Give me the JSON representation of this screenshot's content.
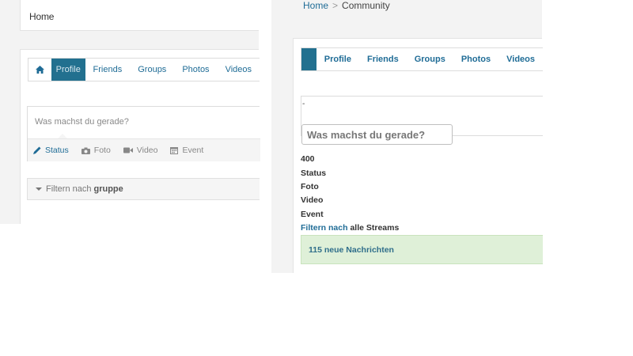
{
  "left": {
    "header": {
      "home_label": "Home"
    },
    "nav": {
      "items": [
        {
          "label": "Profile",
          "active": true
        },
        {
          "label": "Friends"
        },
        {
          "label": "Groups"
        },
        {
          "label": "Photos"
        },
        {
          "label": "Videos"
        }
      ]
    },
    "status": {
      "placeholder": "Was machst du gerade?",
      "options": [
        {
          "label": "Status",
          "icon": "pencil-icon"
        },
        {
          "label": "Foto",
          "icon": "camera-icon"
        },
        {
          "label": "Video",
          "icon": "video-camera-icon"
        },
        {
          "label": "Event",
          "icon": "calendar-icon"
        }
      ]
    },
    "filter": {
      "prefix": "Filtern nach",
      "value": "gruppe"
    }
  },
  "right": {
    "breadcrumb": {
      "home": "Home",
      "current": "Community"
    },
    "nav": {
      "items": [
        "Profile",
        "Friends",
        "Groups",
        "Photos",
        "Videos"
      ]
    },
    "dash": "-",
    "input_placeholder": "Was machst du gerade?",
    "count": "400",
    "options": [
      "Status",
      "Foto",
      "Video",
      "Event"
    ],
    "filter": {
      "prefix": "Filtern nach",
      "value": "alle Streams"
    },
    "alert": "115 neue Nachrichten"
  },
  "colors": {
    "accent": "#22708f",
    "link": "#1f6c96",
    "success_bg": "#dff0d8"
  }
}
